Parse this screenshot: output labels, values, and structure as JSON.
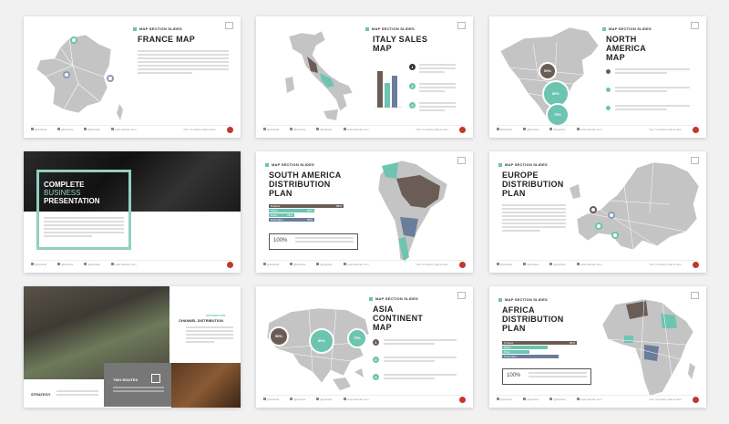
{
  "colors": {
    "accent": "#6cc4b1",
    "dark": "#6b5d56",
    "navy": "#6b7d9c",
    "map_gray": "#c4c4c4"
  },
  "common": {
    "kicker": "MAP SECTION SLIDES",
    "footer_items": [
      "@website",
      "@website",
      "@website",
      "www.website.com"
    ],
    "footer_right": "Your Company Name Here",
    "page_icon": "page-number-box"
  },
  "slides": {
    "france": {
      "title": "FRANCE MAP"
    },
    "italy": {
      "title": "ITALY SALES\nMAP",
      "numbers": [
        "1",
        "2",
        "3"
      ]
    },
    "north_america": {
      "title": "NORTH\nAMERICA\nMAP",
      "circles": [
        "50%",
        "80%",
        "75%"
      ]
    },
    "complete": {
      "line1": "COMPLETE",
      "line2": "BUSINESS",
      "line3": "PRESENTATION"
    },
    "south_america": {
      "title": "SOUTH AMERICA\nDISTRIBUTION\nPLAN",
      "bars": [
        {
          "label": "Product",
          "value": "85%"
        },
        {
          "label": "Place",
          "value": "65%"
        },
        {
          "label": "Price",
          "value": "25%"
        },
        {
          "label": "Promotion",
          "value": "55%"
        }
      ],
      "big": "100%"
    },
    "europe": {
      "title": "EUROPE\nDISTRIBUTION\nPLAN"
    },
    "strategy": {
      "heading_small": "DISTRIBUTION",
      "heading": "CHANNEL DISTRIBUTION",
      "label": "STRATEGY",
      "box_title": "TWO ROUTES"
    },
    "asia": {
      "title": "ASIA\nCONTINENT\nMAP",
      "circles": [
        "50%",
        "80%",
        "75%"
      ],
      "numbers": [
        "1",
        "2",
        "3"
      ]
    },
    "africa": {
      "title": "AFRICA\nDISTRIBUTION\nPLAN",
      "bars": [
        {
          "label": "Product",
          "value": "85%"
        },
        {
          "label": "Place",
          "value": ""
        },
        {
          "label": "Price",
          "value": ""
        },
        {
          "label": "Promotion",
          "value": ""
        }
      ],
      "big": "100%"
    }
  }
}
